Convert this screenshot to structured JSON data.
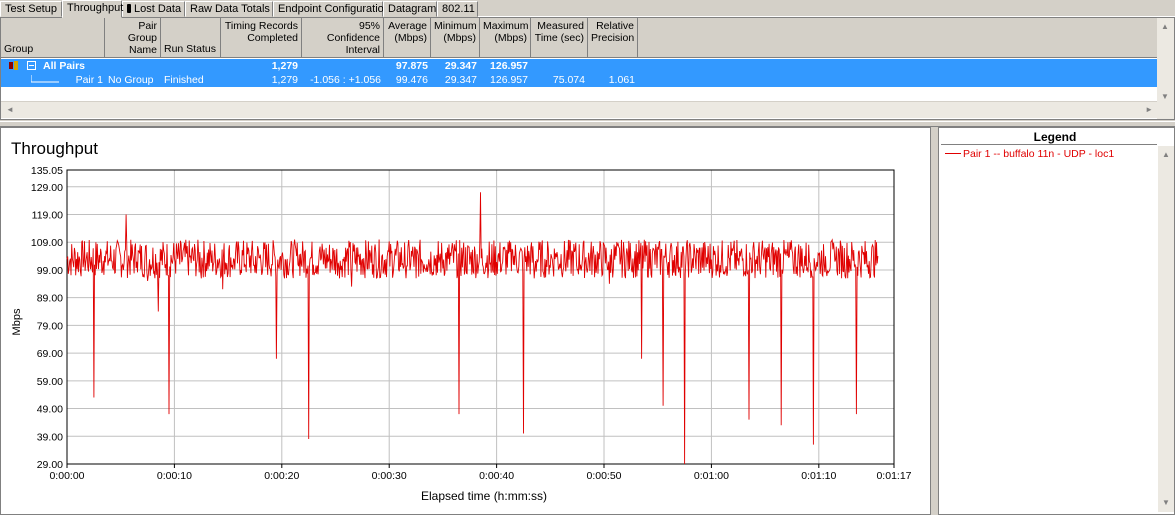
{
  "tabs": [
    "Test Setup",
    "Throughput",
    "Lost Data",
    "Raw Data Totals",
    "Endpoint Configuration",
    "Datagram",
    "802.11"
  ],
  "table": {
    "headers": [
      {
        "id": "group",
        "l1": "",
        "l2": "Group"
      },
      {
        "id": "pgn",
        "l1": "Pair Group",
        "l2": "Name"
      },
      {
        "id": "status",
        "l1": "",
        "l2": "Run Status"
      },
      {
        "id": "timing",
        "l1": "Timing Records",
        "l2": "Completed"
      },
      {
        "id": "ci",
        "l1": "95% Confidence",
        "l2": "Interval"
      },
      {
        "id": "avg",
        "l1": "Average",
        "l2": "(Mbps)"
      },
      {
        "id": "min",
        "l1": "Minimum",
        "l2": "(Mbps)"
      },
      {
        "id": "max",
        "l1": "Maximum",
        "l2": "(Mbps)"
      },
      {
        "id": "time",
        "l1": "Measured",
        "l2": "Time (sec)"
      },
      {
        "id": "prec",
        "l1": "Relative",
        "l2": "Precision"
      }
    ],
    "rows": [
      {
        "group": "All Pairs",
        "pgn": "",
        "status": "",
        "timing": "1,279",
        "ci": "",
        "avg": "97.875",
        "min": "29.347",
        "max": "126.957",
        "time": "",
        "prec": ""
      },
      {
        "group": "Pair 1",
        "pgn": "No Group",
        "status": "Finished",
        "timing": "1,279",
        "ci": "-1.056 : +1.056",
        "avg": "99.476",
        "min": "29.347",
        "max": "126.957",
        "time": "75.074",
        "prec": "1.061"
      }
    ]
  },
  "chart_data": {
    "type": "line",
    "title": "Throughput",
    "xlabel": "Elapsed time (h:mm:ss)",
    "ylabel": "Mbps",
    "ylim": [
      29.0,
      135.05
    ],
    "xlim": [
      "0:00:00",
      "0:01:17"
    ],
    "x_ticks": [
      "0:00:00",
      "0:00:10",
      "0:00:20",
      "0:00:30",
      "0:00:40",
      "0:00:50",
      "0:01:00",
      "0:01:10",
      "0:01:17"
    ],
    "y_ticks": [
      "135.05",
      "129.00",
      "119.00",
      "109.00",
      "99.00",
      "89.00",
      "79.00",
      "69.00",
      "59.00",
      "49.00",
      "39.00",
      "29.00"
    ],
    "grid": true,
    "series": [
      {
        "name": "Pair 1 -- buffalo 11n - UDP - loc1",
        "color": "#e00000",
        "x_sec": [
          0,
          1,
          2,
          3,
          4,
          5,
          6,
          7,
          8,
          9,
          10,
          11,
          12,
          13,
          14,
          15,
          16,
          17,
          18,
          19,
          20,
          21,
          22,
          23,
          24,
          25,
          26,
          27,
          28,
          29,
          30,
          31,
          32,
          33,
          34,
          35,
          36,
          37,
          38,
          39,
          40,
          41,
          42,
          43,
          44,
          45,
          46,
          47,
          48,
          49,
          50,
          51,
          52,
          53,
          54,
          55,
          56,
          57,
          58,
          59,
          60,
          61,
          62,
          63,
          64,
          65,
          66,
          67,
          68,
          69,
          70,
          71,
          72,
          73,
          74,
          75
        ],
        "values": [
          103,
          100,
          53,
          104,
          98,
          119,
          102,
          95,
          84,
          47,
          101,
          104,
          96,
          106,
          92,
          103,
          100,
          98,
          100,
          67,
          103,
          101,
          38,
          106,
          98,
          99,
          93,
          103,
          101,
          99,
          104,
          100,
          96,
          101,
          98,
          103,
          47,
          101,
          127,
          98,
          101,
          106,
          40,
          96,
          103,
          105,
          102,
          99,
          100,
          105,
          94,
          101,
          103,
          67,
          105,
          50,
          98,
          29,
          103,
          100,
          101,
          98,
          103,
          45,
          100,
          99,
          43,
          106,
          100,
          36,
          101,
          102,
          96,
          47,
          100,
          104
        ]
      }
    ]
  },
  "legend": {
    "title": "Legend",
    "item": "Pair 1 -- buffalo 11n - UDP - loc1"
  }
}
